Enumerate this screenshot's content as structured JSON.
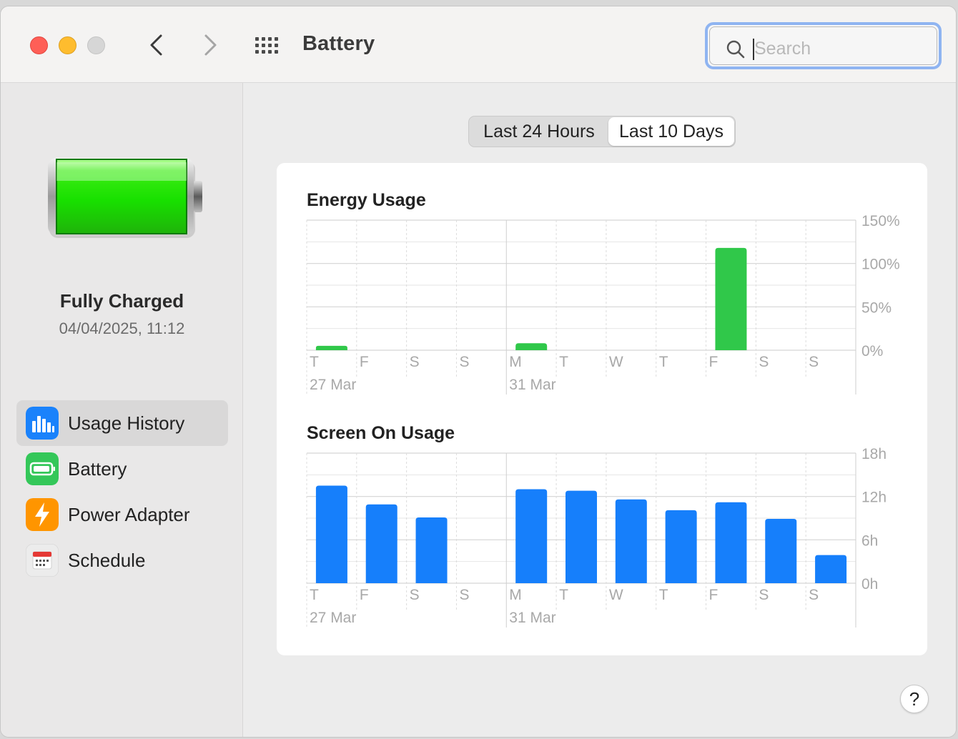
{
  "window": {
    "title": "Battery",
    "search": {
      "placeholder": "Search",
      "value": ""
    }
  },
  "sidebar": {
    "status_title": "Fully Charged",
    "status_time": "04/04/2025, 11:12",
    "items": [
      {
        "label": "Usage History",
        "icon": "bar-chart-icon",
        "color": "#1a82fb",
        "active": true
      },
      {
        "label": "Battery",
        "icon": "battery-icon",
        "color": "#34c759",
        "active": false
      },
      {
        "label": "Power Adapter",
        "icon": "lightning-icon",
        "color": "#ff9500",
        "active": false
      },
      {
        "label": "Schedule",
        "icon": "calendar-icon",
        "color": "#e8e8e8",
        "active": false
      }
    ]
  },
  "range_selector": {
    "options": [
      "Last 24 Hours",
      "Last 10 Days"
    ],
    "selected": "Last 10 Days"
  },
  "help_label": "?",
  "chart_data": [
    {
      "type": "bar",
      "title": "Energy Usage",
      "categories": [
        "T",
        "F",
        "S",
        "S",
        "M",
        "T",
        "W",
        "T",
        "F",
        "S",
        "S"
      ],
      "date_labels": [
        {
          "index": 0,
          "label": "27 Mar"
        },
        {
          "index": 4,
          "label": "31 Mar"
        }
      ],
      "values": [
        5,
        0,
        0,
        0,
        8,
        0,
        0,
        0,
        118,
        0,
        0
      ],
      "ylim": [
        0,
        150
      ],
      "yticks": [
        "0%",
        "50%",
        "100%",
        "150%"
      ],
      "ytick_values": [
        0,
        50,
        100,
        150
      ],
      "color": "#30c84a",
      "grid": true
    },
    {
      "type": "bar",
      "title": "Screen On Usage",
      "categories": [
        "T",
        "F",
        "S",
        "S",
        "M",
        "T",
        "W",
        "T",
        "F",
        "S",
        "S"
      ],
      "date_labels": [
        {
          "index": 0,
          "label": "27 Mar"
        },
        {
          "index": 4,
          "label": "31 Mar"
        }
      ],
      "values": [
        13.5,
        10.9,
        9.1,
        0,
        13,
        12.8,
        11.6,
        10.1,
        11.2,
        8.9,
        3.9
      ],
      "ylim": [
        0,
        18
      ],
      "yticks": [
        "0h",
        "6h",
        "12h",
        "18h"
      ],
      "ytick_values": [
        0,
        6,
        12,
        18
      ],
      "color": "#167ffb",
      "grid": true
    }
  ]
}
